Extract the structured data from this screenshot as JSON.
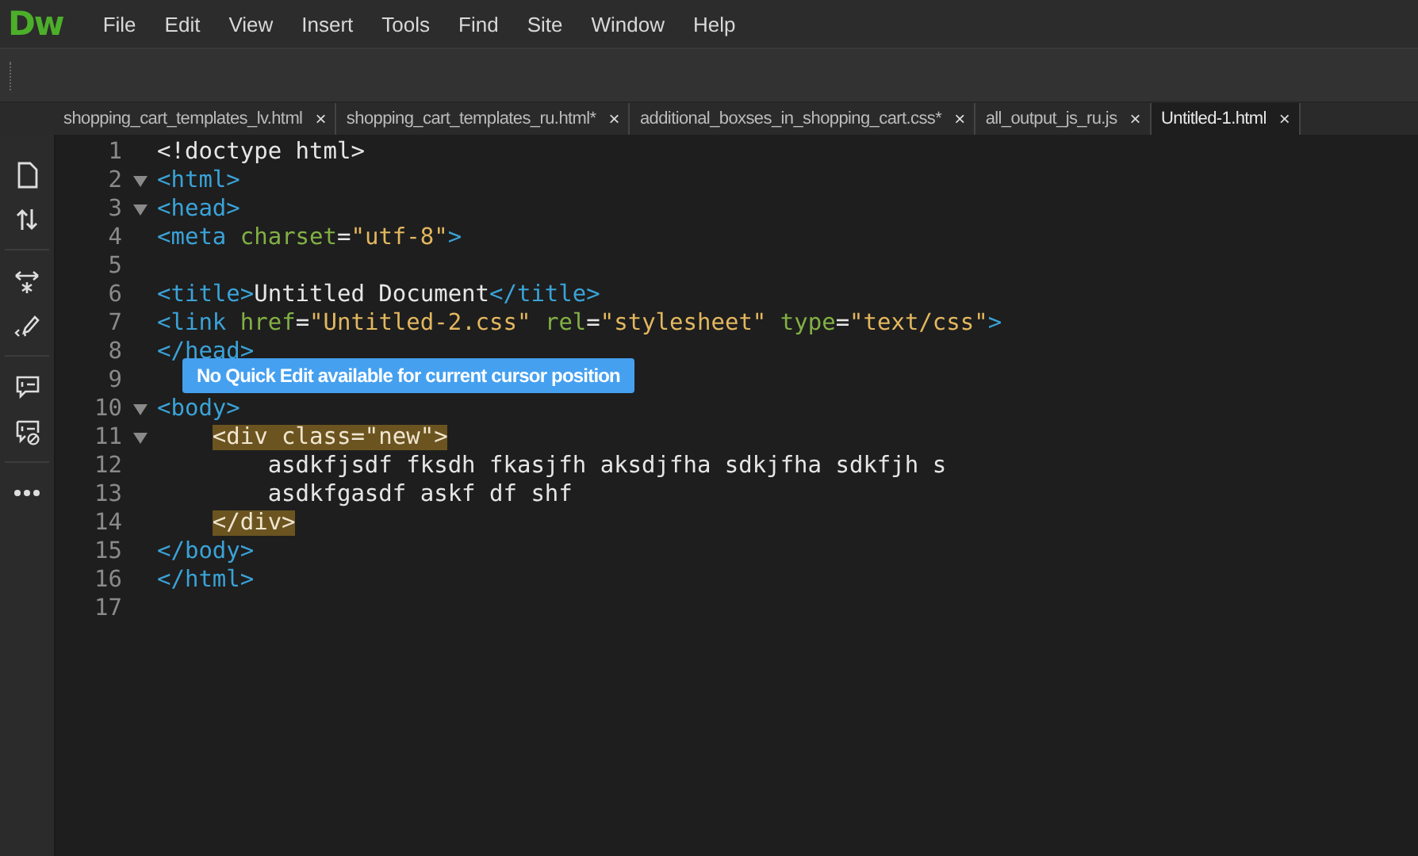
{
  "app": {
    "logo": "Dw"
  },
  "menu": [
    "File",
    "Edit",
    "View",
    "Insert",
    "Tools",
    "Find",
    "Site",
    "Window",
    "Help"
  ],
  "tabs": [
    {
      "label": "shopping_cart_templates_lv.html",
      "selected": false
    },
    {
      "label": "shopping_cart_templates_ru.html*",
      "selected": false
    },
    {
      "label": "additional_boxses_in_shopping_cart.css*",
      "selected": false
    },
    {
      "label": "all_output_js_ru.js",
      "selected": false
    },
    {
      "label": "Untitled-1.html",
      "selected": true
    }
  ],
  "tab_close": "×",
  "code_lines": [
    {
      "number": "1",
      "foldable": false,
      "tokens": [
        {
          "kind": "plain",
          "text": "<!doctype html>"
        }
      ]
    },
    {
      "number": "2",
      "foldable": true,
      "tokens": [
        {
          "kind": "tag",
          "text": "<html>"
        }
      ]
    },
    {
      "number": "3",
      "foldable": true,
      "tokens": [
        {
          "kind": "tag",
          "text": "<head>"
        }
      ]
    },
    {
      "number": "4",
      "foldable": false,
      "tokens": [
        {
          "kind": "tag",
          "text": "<meta "
        },
        {
          "kind": "attr",
          "text": "charset"
        },
        {
          "kind": "plain",
          "text": "="
        },
        {
          "kind": "string",
          "text": "\"utf-8\""
        },
        {
          "kind": "tag",
          "text": ">"
        }
      ]
    },
    {
      "number": "5",
      "foldable": false
    },
    {
      "number": "6",
      "foldable": false,
      "tokens": [
        {
          "kind": "tag",
          "text": "<title>"
        },
        {
          "kind": "plain",
          "text": "Untitled Document"
        },
        {
          "kind": "tag",
          "text": "</title>"
        }
      ]
    },
    {
      "number": "7",
      "foldable": false,
      "tokens": [
        {
          "kind": "tag",
          "text": "<link "
        },
        {
          "kind": "attr",
          "text": "href"
        },
        {
          "kind": "plain",
          "text": "="
        },
        {
          "kind": "string",
          "text": "\"Untitled-2.css\""
        },
        {
          "kind": "attr",
          "text": " rel"
        },
        {
          "kind": "plain",
          "text": "="
        },
        {
          "kind": "string",
          "text": "\"stylesheet\""
        },
        {
          "kind": "attr",
          "text": " type"
        },
        {
          "kind": "plain",
          "text": "="
        },
        {
          "kind": "string",
          "text": "\"text/css\""
        },
        {
          "kind": "tag",
          "text": ">"
        }
      ]
    },
    {
      "number": "8",
      "foldable": false,
      "tokens": [
        {
          "kind": "tag",
          "text": "</head>"
        }
      ]
    },
    {
      "number": "9",
      "foldable": false
    },
    {
      "number": "10",
      "foldable": true,
      "tokens": [
        {
          "kind": "tag",
          "text": "<body>"
        }
      ],
      "children": [
        {
          "number": "11",
          "foldable": true,
          "tokens": [
            {
              "kind": "highlight",
              "text": "<div class=\"new\">"
            }
          ],
          "children": [
            {
              "number": "12",
              "foldable": false,
              "tokens": [
                {
                  "kind": "plain",
                  "text": "asdkfjsdf fksdh fkasjfh aksdjfha sdkjfha sdkfjh s"
                }
              ]
            },
            {
              "number": "13",
              "foldable": false,
              "tokens": [
                {
                  "kind": "plain",
                  "text": "asdkfgasdf askf df shf"
                }
              ]
            }
          ]
        },
        {
          "number": "14",
          "foldable": false,
          "tokens": [
            {
              "kind": "highlight",
              "text": "</div>"
            }
          ]
        }
      ]
    },
    {
      "number": "15",
      "foldable": false,
      "tokens": [
        {
          "kind": "tag",
          "text": "</body>"
        }
      ]
    },
    {
      "number": "16",
      "foldable": false,
      "tokens": [
        {
          "kind": "tag",
          "text": "</html>"
        }
      ]
    },
    {
      "number": "17",
      "foldable": false
    }
  ],
  "tooltip": "No Quick Edit available for current cursor position"
}
